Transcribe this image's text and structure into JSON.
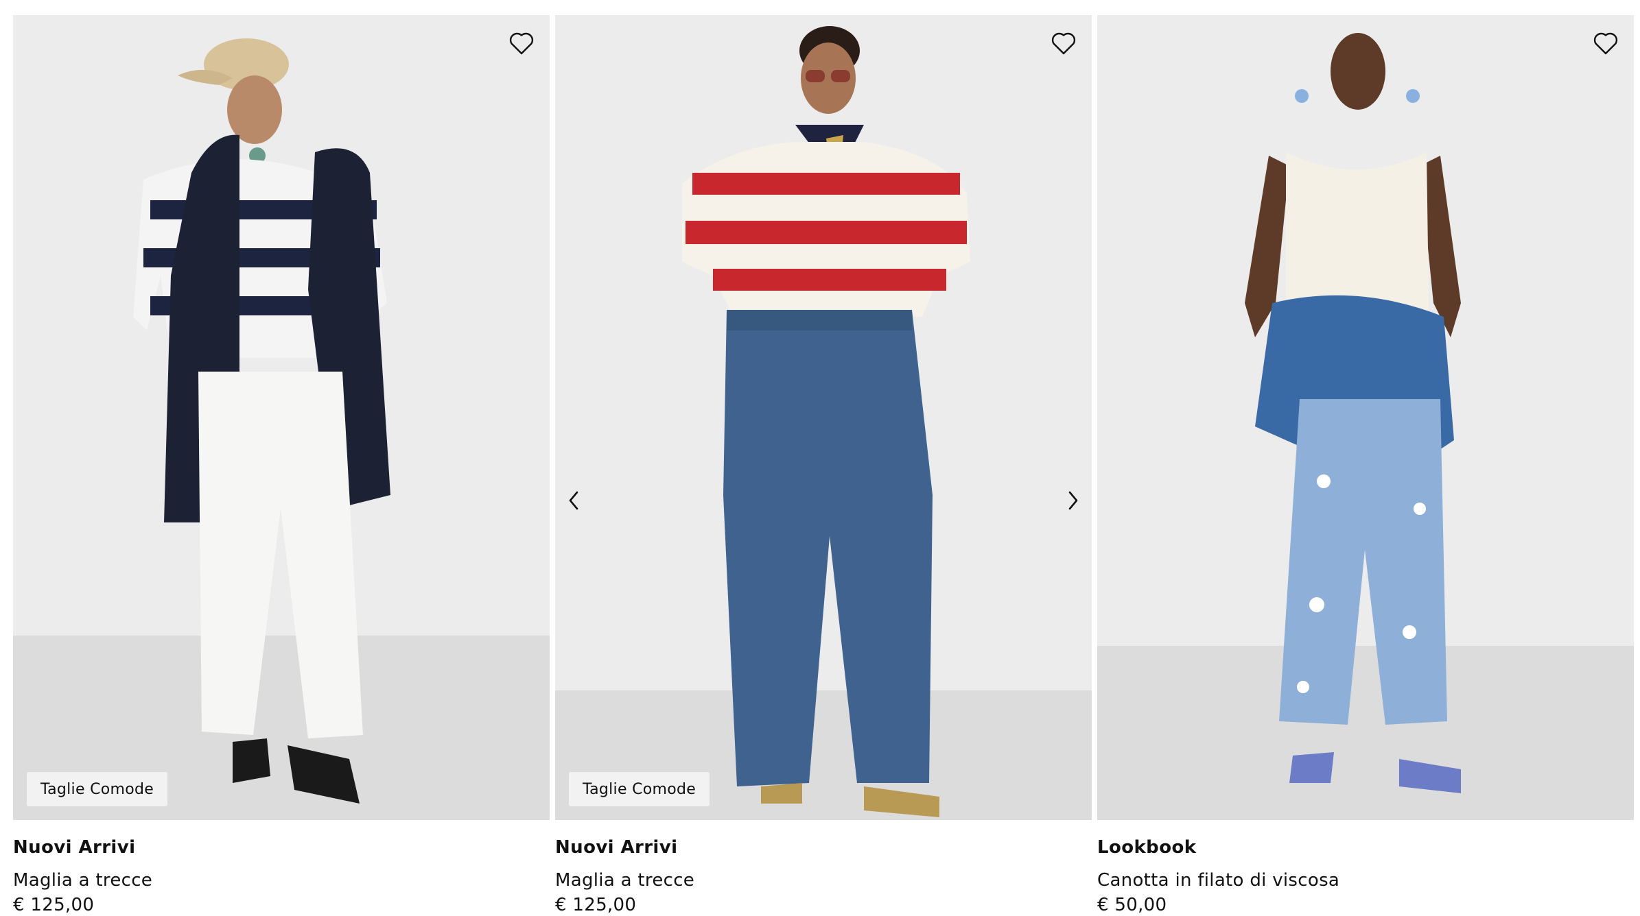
{
  "colors": {
    "text": "#111111",
    "badge_bg": "#f2f2f2",
    "studio_wall": "#ececec",
    "studio_floor": "#dcdcdc"
  },
  "icons": {
    "wishlist": "heart-outline-icon",
    "prev": "chevron-left-icon",
    "next": "chevron-right-icon"
  },
  "products": [
    {
      "badge": "Taglie Comode",
      "category": "Nuovi Arrivi",
      "name": "Maglia a trecce",
      "price": "€ 125,00"
    },
    {
      "badge": "Taglie Comode",
      "category": "Nuovi Arrivi",
      "name": "Maglia a trecce",
      "price": "€ 125,00"
    },
    {
      "category": "Lookbook",
      "name": "Canotta in filato di viscosa",
      "price": "€ 50,00"
    }
  ]
}
